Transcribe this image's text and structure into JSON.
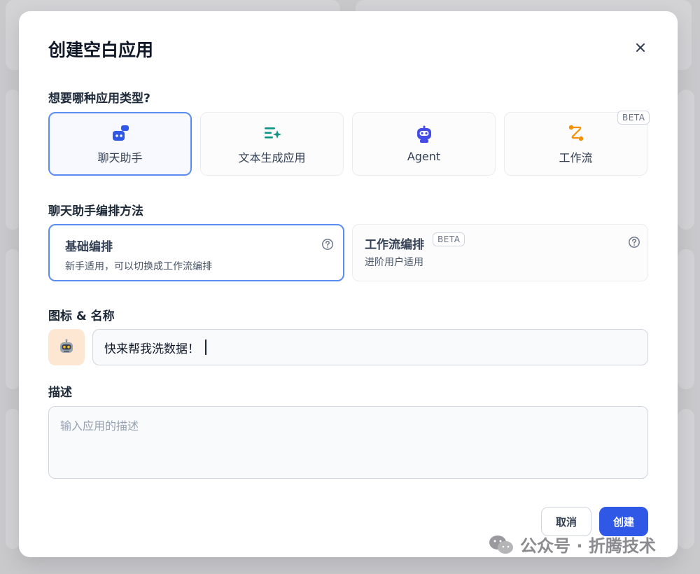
{
  "dialog": {
    "title": "创建空白应用",
    "close_label": "×"
  },
  "app_type": {
    "question": "想要哪种应用类型?",
    "options": [
      {
        "label": "聊天助手",
        "icon": "chat-bot-icon",
        "selected": true
      },
      {
        "label": "文本生成应用",
        "icon": "text-generate-icon",
        "selected": false
      },
      {
        "label": "Agent",
        "icon": "agent-robot-icon",
        "selected": false
      },
      {
        "label": "工作流",
        "icon": "workflow-icon",
        "selected": false,
        "badge": "BETA"
      }
    ]
  },
  "orchestration": {
    "label": "聊天助手编排方法",
    "options": [
      {
        "title": "基础编排",
        "desc": "新手适用，可以切换成工作流编排",
        "selected": true
      },
      {
        "title": "工作流编排",
        "badge": "BETA",
        "desc": "进阶用户适用",
        "selected": false
      }
    ]
  },
  "icon_name": {
    "label": "图标 & 名称",
    "icon": "robot-emoji-icon",
    "value": "快来帮我洗数据！"
  },
  "description": {
    "label": "描述",
    "placeholder": "输入应用的描述"
  },
  "footer": {
    "cancel_label": "取消",
    "create_label": "创建"
  },
  "watermark": {
    "text": "公众号 · 折腾技术"
  },
  "colors": {
    "accent": "#2f58e6",
    "selected_border": "#5b8def",
    "icon_bg": "#fde7d2"
  }
}
